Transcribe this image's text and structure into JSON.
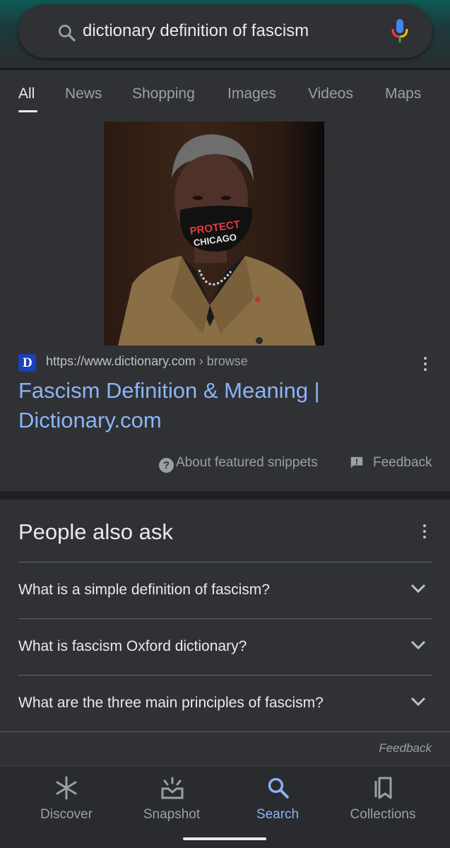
{
  "search": {
    "query": "dictionary definition of fascism"
  },
  "tabs": [
    {
      "label": "All",
      "active": true
    },
    {
      "label": "News",
      "active": false
    },
    {
      "label": "Shopping",
      "active": false
    },
    {
      "label": "Images",
      "active": false
    },
    {
      "label": "Videos",
      "active": false
    },
    {
      "label": "Maps",
      "active": false
    }
  ],
  "featured_snippet": {
    "image": {
      "mask_text_line1": "PROTECT",
      "mask_text_line2": "CHICAGO"
    },
    "favicon_letter": "D",
    "source_url": "https://www.dictionary.com",
    "source_path": " › browse",
    "title": "Fascism Definition & Meaning | Dictionary.com",
    "about_label": "About featured snippets",
    "feedback_label": "Feedback"
  },
  "people_also_ask": {
    "heading": "People also ask",
    "questions": [
      "What is a simple definition of fascism?",
      "What is fascism Oxford dictionary?",
      "What are the three main principles of fascism?"
    ],
    "feedback_label": "Feedback"
  },
  "bottom_nav": [
    {
      "label": "Discover",
      "icon": "asterisk-icon",
      "active": false
    },
    {
      "label": "Snapshot",
      "icon": "snapshot-icon",
      "active": false
    },
    {
      "label": "Search",
      "icon": "search-icon",
      "active": true
    },
    {
      "label": "Collections",
      "icon": "collections-icon",
      "active": false
    }
  ],
  "colors": {
    "background": "#303134",
    "link": "#8ab4f8",
    "text_primary": "#e8eaed",
    "text_secondary": "#9aa0a6",
    "mic_blue": "#4285f4",
    "mic_red": "#ea4335",
    "mic_yellow": "#fbbc05",
    "mic_green": "#34a853"
  }
}
